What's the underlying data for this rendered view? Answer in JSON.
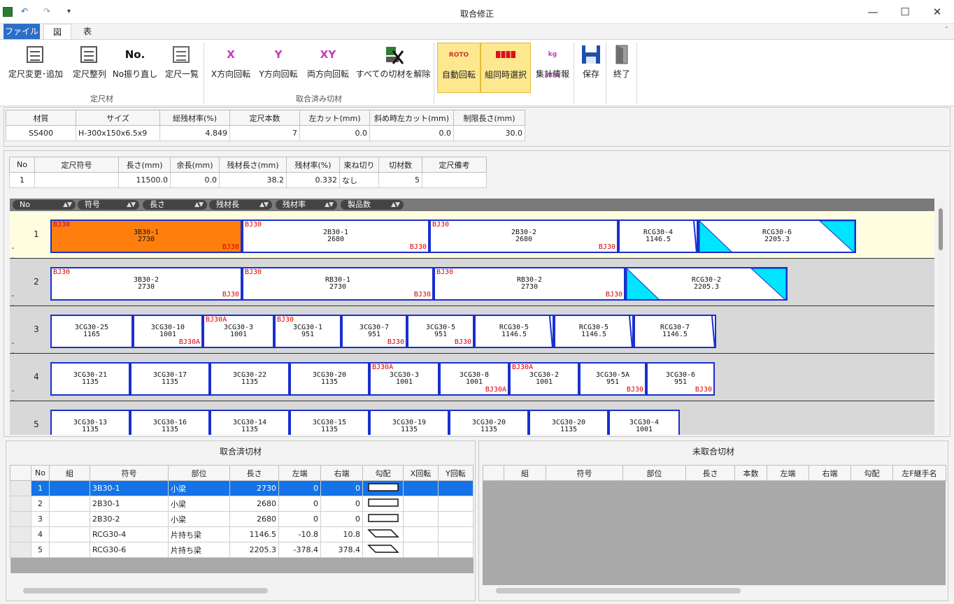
{
  "window": {
    "title": "取合修正",
    "undo": "↶",
    "redo": "↷",
    "customize": "▾",
    "minimize": "—",
    "maximize": "☐",
    "close": "✕"
  },
  "ribbon_tabs": [
    {
      "label": "ファイル",
      "active": false
    },
    {
      "label": "図",
      "active": true
    },
    {
      "label": "表",
      "active": false
    }
  ],
  "ribbon": {
    "collapse_icon": "ˆ",
    "buttons": [
      {
        "label": "定尺変更･追加",
        "icon": "edit-stock-icon",
        "toggled": false
      },
      {
        "label": "定尺整列",
        "icon": "sort-stock-icon",
        "toggled": false
      },
      {
        "label": "No振り直し",
        "icon": "renumber-icon",
        "icon_text": "No.",
        "toggled": false
      },
      {
        "label": "定尺一覧",
        "icon": "stock-list-icon",
        "toggled": false
      },
      {
        "label": "X方向回転",
        "icon": "rotate-x-icon",
        "icon_text": "X",
        "toggled": false
      },
      {
        "label": "Y方向回転",
        "icon": "rotate-y-icon",
        "icon_text": "Y",
        "toggled": false
      },
      {
        "label": "両方向回転",
        "icon": "rotate-xy-icon",
        "icon_text": "XY",
        "toggled": false
      },
      {
        "label": "すべての切材を解除",
        "icon": "release-all-icon",
        "toggled": false
      },
      {
        "label": "自動回転",
        "icon": "auto-rotate-icon",
        "icon_text": "ROTO",
        "toggled": true
      },
      {
        "label": "組同時選択",
        "icon": "group-select-icon",
        "toggled": true
      },
      {
        "label": "集計情報",
        "icon": "summary-icon",
        "icon_text": "kg mm",
        "toggled": false
      },
      {
        "label": "保存",
        "icon": "save-icon",
        "toggled": false
      },
      {
        "label": "終了",
        "icon": "exit-icon",
        "toggled": false
      }
    ],
    "groups": [
      "定尺材",
      "取合済み切材"
    ]
  },
  "material_table": {
    "headers": [
      "材質",
      "サイズ",
      "総残材率(%)",
      "定尺本数",
      "左カット(mm)",
      "斜め時左カット(mm)",
      "制限長さ(mm)"
    ],
    "row": [
      "SS400",
      "H-300x150x6.5x9",
      "4.849",
      "7",
      "0.0",
      "0.0",
      "30.0"
    ]
  },
  "stock_table": {
    "headers": [
      "No",
      "定尺符号",
      "長さ(mm)",
      "余長(mm)",
      "残材長さ(mm)",
      "残材率(%)",
      "束ね切り",
      "切材数",
      "定尺備考"
    ],
    "row": [
      "1",
      "",
      "11500.0",
      "0.0",
      "38.2",
      "0.332",
      "なし",
      "5",
      ""
    ]
  },
  "sort_bar": [
    "No",
    "符号",
    "長さ",
    "残材長",
    "残材率",
    "製品数"
  ],
  "sort_arrows": "▲▼",
  "stock_rows": [
    {
      "no": "1",
      "selected": true,
      "pieces": [
        {
          "code": "3B30-1",
          "len": "2730",
          "tl": "BJ30",
          "br": "BJ30",
          "hi": true,
          "shape": "rect"
        },
        {
          "code": "2B30-1",
          "len": "2680",
          "tl": "BJ30",
          "br": "BJ30",
          "shape": "rect"
        },
        {
          "code": "2B30-2",
          "len": "2680",
          "tl": "BJ30",
          "br": "BJ30",
          "shape": "rect"
        },
        {
          "code": "RCG30-4",
          "len": "1146.5",
          "tl": "",
          "br": "",
          "shape": "slantR"
        },
        {
          "code": "RCG30-6",
          "len": "2205.3",
          "tl": "",
          "br": "",
          "shape": "tri"
        }
      ]
    },
    {
      "no": "2",
      "selected": false,
      "pieces": [
        {
          "code": "3B30-2",
          "len": "2730",
          "tl": "BJ30",
          "br": "BJ30",
          "shape": "rect"
        },
        {
          "code": "RB30-1",
          "len": "2730",
          "tl": "BJ30",
          "br": "BJ30",
          "shape": "rect"
        },
        {
          "code": "RB30-2",
          "len": "2730",
          "tl": "BJ30",
          "br": "BJ30",
          "shape": "rect"
        },
        {
          "code": "RCG30-2",
          "len": "2205.3",
          "tl": "",
          "br": "",
          "shape": "tri2"
        }
      ]
    },
    {
      "no": "3",
      "selected": false,
      "pieces": [
        {
          "code": "3CG30-25",
          "len": "1165",
          "tl": "",
          "br": "",
          "shape": "rect"
        },
        {
          "code": "3CG30-10",
          "len": "1001",
          "tl": "",
          "br": "BJ30A",
          "shape": "rect"
        },
        {
          "code": "3CG30-3",
          "len": "1001",
          "tl": "BJ30A",
          "br": "",
          "shape": "rect"
        },
        {
          "code": "3CG30-1",
          "len": "951",
          "tl": "BJ30",
          "br": "",
          "shape": "rect"
        },
        {
          "code": "3CG30-7",
          "len": "951",
          "tl": "",
          "br": "BJ30",
          "shape": "rect"
        },
        {
          "code": "3CG30-5",
          "len": "951",
          "tl": "",
          "br": "BJ30",
          "shape": "rect"
        },
        {
          "code": "RCG30-5",
          "len": "1146.5",
          "tl": "",
          "br": "",
          "shape": "slantR"
        },
        {
          "code": "RCG30-5",
          "len": "1146.5",
          "tl": "",
          "br": "",
          "shape": "slantR"
        },
        {
          "code": "RCG30-7",
          "len": "1146.5",
          "tl": "",
          "br": "",
          "shape": "slantR"
        }
      ]
    },
    {
      "no": "4",
      "selected": false,
      "pieces": [
        {
          "code": "3CG30-21",
          "len": "1135",
          "tl": "",
          "br": "",
          "shape": "rect"
        },
        {
          "code": "3CG30-17",
          "len": "1135",
          "tl": "",
          "br": "",
          "shape": "rect"
        },
        {
          "code": "3CG30-22",
          "len": "1135",
          "tl": "",
          "br": "",
          "shape": "rect"
        },
        {
          "code": "3CG30-20",
          "len": "1135",
          "tl": "",
          "br": "",
          "shape": "rect"
        },
        {
          "code": "3CG30-3",
          "len": "1001",
          "tl": "BJ30A",
          "br": "",
          "shape": "rect"
        },
        {
          "code": "3CG30-8",
          "len": "1001",
          "tl": "",
          "br": "BJ30A",
          "shape": "rect"
        },
        {
          "code": "3CG30-2",
          "len": "1001",
          "tl": "BJ30A",
          "br": "",
          "shape": "rect"
        },
        {
          "code": "3CG30-5A",
          "len": "951",
          "tl": "",
          "br": "BJ30",
          "shape": "rect"
        },
        {
          "code": "3CG30-6",
          "len": "951",
          "tl": "",
          "br": "BJ30",
          "shape": "rect"
        }
      ]
    },
    {
      "no": "5",
      "selected": false,
      "pieces": [
        {
          "code": "3CG30-13",
          "len": "1135",
          "tl": "",
          "br": "",
          "shape": "rect"
        },
        {
          "code": "3CG30-16",
          "len": "1135",
          "tl": "",
          "br": "",
          "shape": "rect"
        },
        {
          "code": "3CG30-14",
          "len": "1135",
          "tl": "",
          "br": "",
          "shape": "rect"
        },
        {
          "code": "3CG30-15",
          "len": "1135",
          "tl": "",
          "br": "",
          "shape": "rect"
        },
        {
          "code": "3CG30-19",
          "len": "1135",
          "tl": "",
          "br": "",
          "shape": "rect"
        },
        {
          "code": "3CG30-20",
          "len": "1135",
          "tl": "",
          "br": "",
          "shape": "rect"
        },
        {
          "code": "3CG30-20",
          "len": "1135",
          "tl": "",
          "br": "",
          "shape": "rect"
        },
        {
          "code": "3CG30-4",
          "len": "1001",
          "tl": "",
          "br": "",
          "shape": "rect"
        }
      ]
    }
  ],
  "placed_panel": {
    "title": "取合済切材",
    "headers": [
      "",
      "No",
      "組",
      "符号",
      "部位",
      "長さ",
      "左端",
      "右端",
      "勾配",
      "X回転",
      "Y回転"
    ],
    "rows": [
      {
        "no": "1",
        "group": "",
        "code": "3B30-1",
        "part": "小梁",
        "len": "2730",
        "left": "0",
        "right": "0",
        "slope": "rect",
        "selected": true
      },
      {
        "no": "2",
        "group": "",
        "code": "2B30-1",
        "part": "小梁",
        "len": "2680",
        "left": "0",
        "right": "0",
        "slope": "rect"
      },
      {
        "no": "3",
        "group": "",
        "code": "2B30-2",
        "part": "小梁",
        "len": "2680",
        "left": "0",
        "right": "0",
        "slope": "rect"
      },
      {
        "no": "4",
        "group": "",
        "code": "RCG30-4",
        "part": "片持ち梁",
        "len": "1146.5",
        "left": "-10.8",
        "right": "10.8",
        "slope": "para"
      },
      {
        "no": "5",
        "group": "",
        "code": "RCG30-6",
        "part": "片持ち梁",
        "len": "2205.3",
        "left": "-378.4",
        "right": "378.4",
        "slope": "para"
      }
    ]
  },
  "unplaced_panel": {
    "title": "未取合切材",
    "headers": [
      "",
      "組",
      "符号",
      "部位",
      "長さ",
      "本数",
      "左端",
      "右端",
      "勾配",
      "左F継手名"
    ]
  },
  "colors": {
    "highlight_piece": "#ff7f0e",
    "piece_border": "#1a2fd0",
    "triangle_fill": "#00e5ff",
    "joint_label": "#d00000",
    "selection": "#1473e6",
    "toggle": "#fde88f"
  }
}
